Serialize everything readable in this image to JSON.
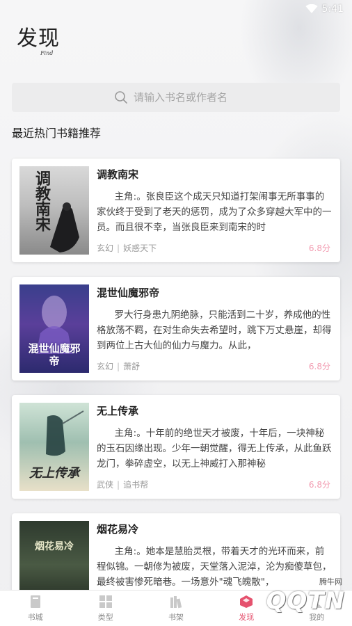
{
  "status": {
    "time": "5:41"
  },
  "header": {
    "title": "发现",
    "subtitle": "Find"
  },
  "search": {
    "placeholder": "请输入书名或作者名"
  },
  "section": {
    "title": "最近热门书籍推荐"
  },
  "books": [
    {
      "title": "调教南宋",
      "cover_text": "调教南宋",
      "description": "主角:。张良臣这个成天只知道打架闹事无所事事的家伙终于受到了老天的惩罚，成为了众多穿越大军中的一员。而且很不幸，当张良臣来到南宋的时",
      "genre": "玄幻",
      "author": "妖惑天下",
      "score": "6.8分"
    },
    {
      "title": "混世仙魔邪帝",
      "cover_text": "混世仙魔邪帝",
      "description": "罗大行身患九阴绝脉，只能活到二十岁，养成他的性格放荡不羁，在对生命失去希望时，跳下万丈悬崖，却得到两位上古大仙的仙力与魔力。从此，",
      "genre": "玄幻",
      "author": "萧舒",
      "score": "6.8分"
    },
    {
      "title": "无上传承",
      "cover_text": "无上传承",
      "description": "主角:。十年前的绝世天才被废，十年后，一块神秘的玉石因缘出现。少年一朝觉醒，得无上传承，从此鱼跃龙门，拳碎虚空，以无上神威打入那神秘",
      "genre": "武侠",
      "author": "追书帮",
      "score": "6.8分"
    },
    {
      "title": "烟花易冷",
      "cover_text": "烟花易冷",
      "description": "主角:。她本是慧胎灵根，带着天才的光环而来，前程似锦。一朝修为被废，天堂落入泥淖，沦为痴傻草包，最终被害惨死暗巷。一场意外\"魂飞魄散\"，",
      "genre": "",
      "author": "",
      "score": ""
    }
  ],
  "nav": {
    "items": [
      {
        "label": "书城",
        "icon": "book-city-icon"
      },
      {
        "label": "类型",
        "icon": "grid-icon"
      },
      {
        "label": "书架",
        "icon": "bookshelf-icon"
      },
      {
        "label": "发现",
        "icon": "discover-icon"
      },
      {
        "label": "我的",
        "icon": "profile-icon"
      }
    ],
    "active": "发现"
  },
  "watermark": {
    "small": "腾牛网",
    "big": "QQTN"
  },
  "colors": {
    "accent": "#e5526e",
    "score": "#f29bb0",
    "card_bg": "#ffffff",
    "page_bg": "#f3f3f4"
  }
}
